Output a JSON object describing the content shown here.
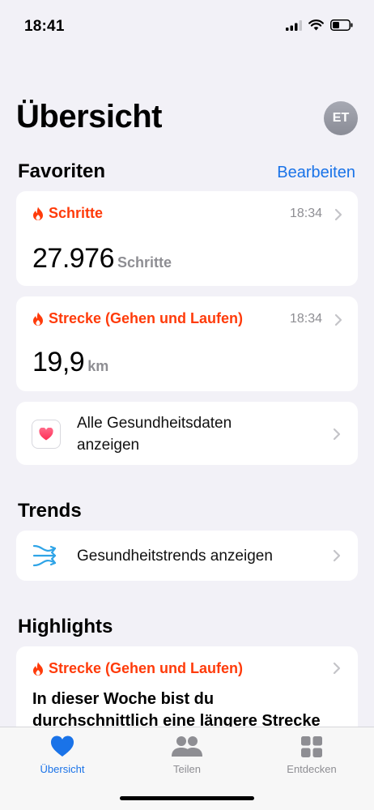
{
  "status": {
    "time": "18:41"
  },
  "header": {
    "title": "Übersicht",
    "avatar_initials": "ET"
  },
  "favorites": {
    "title": "Favoriten",
    "edit_label": "Bearbeiten",
    "cards": [
      {
        "label": "Schritte",
        "time": "18:34",
        "value": "27.976",
        "unit": "Schritte",
        "icon": "flame-icon"
      },
      {
        "label": "Strecke (Gehen und Laufen)",
        "time": "18:34",
        "value": "19,9",
        "unit": "km",
        "icon": "flame-icon"
      }
    ],
    "all_data": {
      "line1": "Alle Gesundheitsdaten",
      "line2": "anzeigen"
    }
  },
  "trends": {
    "title": "Trends",
    "item_label": "Gesundheitstrends anzeigen"
  },
  "highlights": {
    "title": "Highlights",
    "card": {
      "label": "Strecke (Gehen und Laufen)",
      "line1": "In dieser Woche bist du",
      "line2": "durchschnittlich eine längere Strecke"
    }
  },
  "tabs": [
    {
      "label": "Übersicht",
      "icon": "heart-icon",
      "active": true
    },
    {
      "label": "Teilen",
      "icon": "people-icon",
      "active": false
    },
    {
      "label": "Entdecken",
      "icon": "grid-icon",
      "active": false
    }
  ],
  "colors": {
    "accent": "#1a73e8",
    "flame": "#ff3b0a",
    "background": "#f2f1f7"
  }
}
